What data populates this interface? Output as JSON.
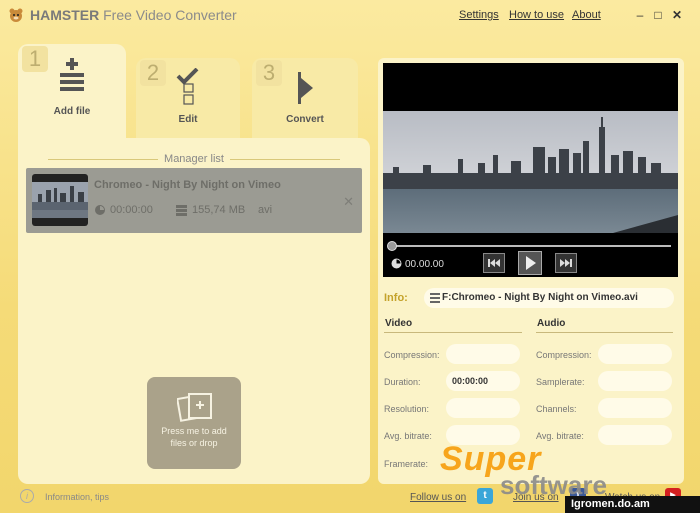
{
  "app": {
    "title_bold": "HAMSTER",
    "title_rest": "Free Video Converter"
  },
  "menu": {
    "settings": "Settings",
    "how_to_use": "How to use",
    "about": "About"
  },
  "window_controls": {
    "minimize": "–",
    "maximize": "□",
    "close": "✕"
  },
  "steps": [
    {
      "num": "1",
      "label": "Add file"
    },
    {
      "num": "2",
      "label": "Edit"
    },
    {
      "num": "3",
      "label": "Convert"
    }
  ],
  "manager": {
    "title": "Manager list",
    "file": {
      "name": "Chromeo - Night By Night on Vimeo",
      "duration": "00:00:00",
      "size": "155,74 MB",
      "format": "avi"
    },
    "drop_text_1": "Press me to add",
    "drop_text_2": "files or drop"
  },
  "player": {
    "time": "00.00.00"
  },
  "info": {
    "label": "Info:",
    "file_path": "F:Chromeo - Night By Night on Vimeo.avi"
  },
  "video": {
    "title": "Video",
    "compression_label": "Compression:",
    "duration_label": "Duration:",
    "duration_value": "00:00:00",
    "resolution_label": "Resolution:",
    "bitrate_label": "Avg. bitrate:",
    "framerate_label": "Framerate:"
  },
  "audio": {
    "title": "Audio",
    "compression_label": "Compression:",
    "samplerate_label": "Samplerate:",
    "channels_label": "Channels:",
    "bitrate_label": "Avg. bitrate:"
  },
  "footer": {
    "info_tips": "Information, tips",
    "follow_us": "Follow us on",
    "join_us": "Join us on",
    "watch_us": "Watch us on"
  },
  "watermark": {
    "super": "Super",
    "software": "software",
    "site": "Igromen.do.am"
  },
  "colors": {
    "accent": "#c4a22a",
    "background": "#f5db78",
    "panel": "#fbf3c8",
    "selected_row": "#9b9b93"
  }
}
